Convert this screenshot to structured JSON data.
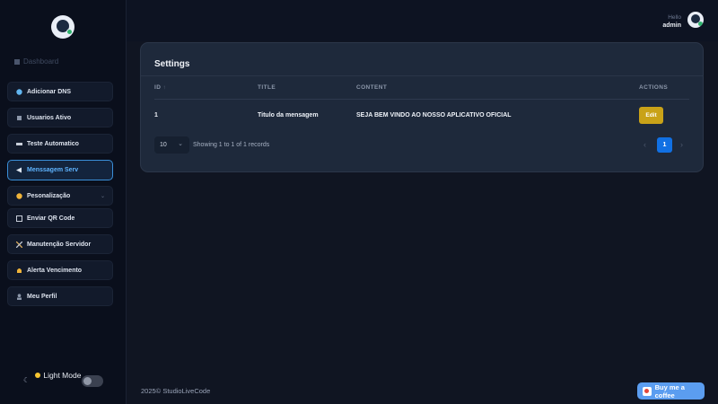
{
  "sidebar": {
    "dashboard_label": "Dashboard",
    "items": [
      {
        "label": "Adicionar DNS",
        "icon": "circle-icon"
      },
      {
        "label": "Usuarios Ativo",
        "icon": "users-icon"
      },
      {
        "label": "Teste Automatico",
        "icon": "monitor-icon"
      },
      {
        "label": "Menssagem Serv",
        "icon": "megaphone-icon",
        "active": true
      },
      {
        "label": "Pesonalização",
        "icon": "palette-icon",
        "has_submenu": true
      },
      {
        "label": "Enviar QR Code",
        "icon": "qrcode-icon"
      },
      {
        "label": "Manutenção Servidor",
        "icon": "tools-icon"
      },
      {
        "label": "Alerta Vencimento",
        "icon": "bell-icon"
      },
      {
        "label": "Meu Perfil",
        "icon": "user-icon"
      }
    ],
    "mode_label": "Light Mode"
  },
  "header": {
    "greeting": "Hello",
    "username": "admin"
  },
  "card": {
    "title": "Settings",
    "columns": [
      "ID",
      "TITLE",
      "CONTENT",
      "ACTIONS"
    ],
    "rows": [
      {
        "id": "1",
        "title": "Titulo da mensagem",
        "content": "SEJA BEM VINDO AO NOSSO APLICATIVO OFICIAL",
        "action": "Edit"
      }
    ],
    "per_page": "10",
    "showing_text": "Showing 1 to 1 of 1 records",
    "current_page": "1"
  },
  "footer": {
    "year": "2025©",
    "brand": "StudioLiveCode",
    "coffee_label": "Buy me a coffee"
  },
  "colors": {
    "accent": "#1170e3",
    "edit_button": "#c9a218",
    "active_nav": "#5fb4ff"
  }
}
